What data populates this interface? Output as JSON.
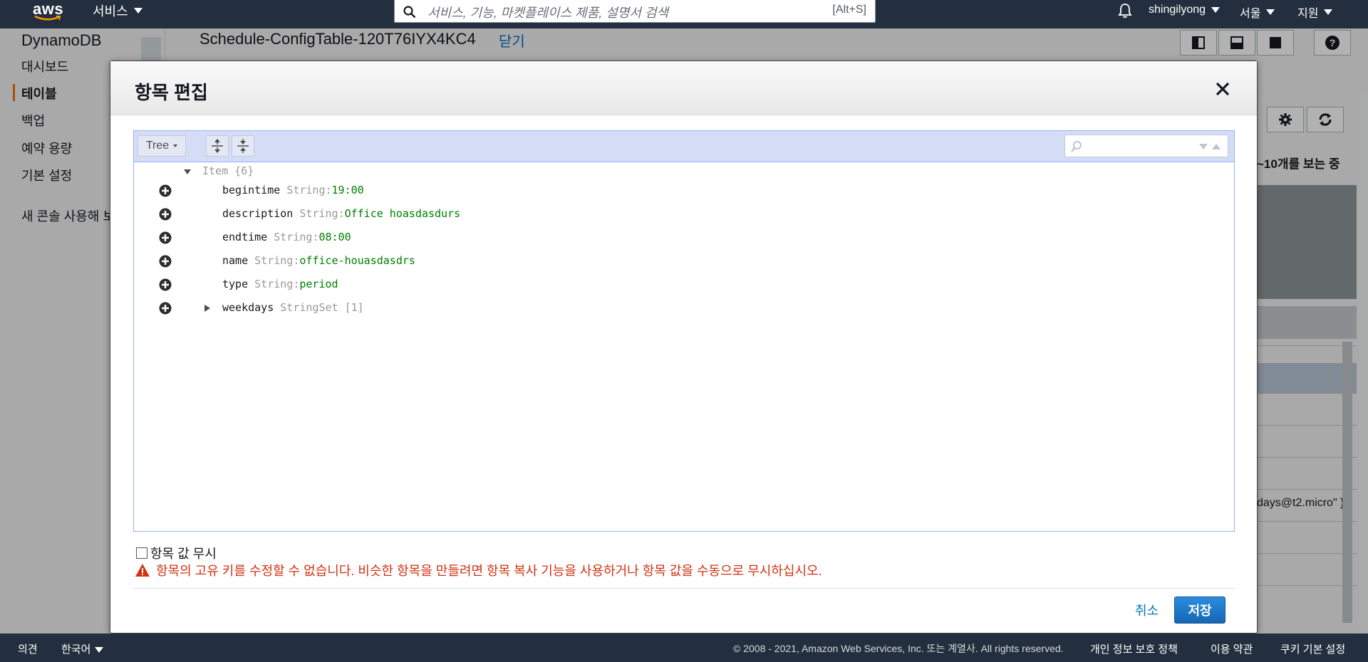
{
  "topnav": {
    "logo_text": "aws",
    "services_label": "서비스",
    "search_placeholder": "서비스, 기능, 마켓플레이스 제품, 설명서 검색",
    "search_shortcut": "[Alt+S]",
    "user": "shingilyong",
    "region": "서울",
    "support": "지원"
  },
  "sidebar": {
    "title": "DynamoDB",
    "items": [
      {
        "label": "대시보드"
      },
      {
        "label": "테이블",
        "active": true
      },
      {
        "label": "백업"
      },
      {
        "label": "예약 용량"
      },
      {
        "label": "기본 설정"
      }
    ],
    "new_console": "새 콘솔 사용해 보"
  },
  "background": {
    "table_title": "Schedule-ConfigTable-120T76IYX4KC4",
    "close_label": "닫기",
    "showing_text": "~10개를 보는 중",
    "cell_text": "days@t2.micro\" }"
  },
  "modal": {
    "title": "항목 편집",
    "editor": {
      "mode_label": "Tree",
      "root": {
        "label": "Item {6}"
      },
      "fields": [
        {
          "key": "begintime",
          "type": "String",
          "sep": ":",
          "value": "19:00"
        },
        {
          "key": "description",
          "type": "String",
          "sep": ":",
          "value": "Office hoasdasdurs"
        },
        {
          "key": "endtime",
          "type": "String",
          "sep": ":",
          "value": "08:00"
        },
        {
          "key": "name",
          "type": "String",
          "sep": ":",
          "value": "office-houasdasdrs"
        },
        {
          "key": "type",
          "type": "String",
          "sep": ":",
          "value": "period"
        },
        {
          "key": "weekdays",
          "type": "StringSet [1]",
          "sep": "",
          "value": ""
        }
      ]
    },
    "ignore_label": "항목 값 무시",
    "warning": "항목의 고유 키를 수정할 수 없습니다. 비슷한 항목을 만들려면 항목 복사 기능을 사용하거나 항목 값을 수동으로 무시하십시오.",
    "cancel_label": "취소",
    "save_label": "저장"
  },
  "footer": {
    "feedback": "의견",
    "language": "한국어",
    "copyright": "© 2008 - 2021, Amazon Web Services, Inc. 또는 계열사. All rights reserved.",
    "privacy": "개인 정보 보호 정책",
    "terms": "이용 약관",
    "cookies": "쿠키 기본 설정"
  },
  "colors": {
    "nav_bg": "#232f3e",
    "accent_orange": "#ec7211",
    "link_blue": "#0073bb",
    "error_red": "#d13212",
    "json_value_green": "#008000",
    "editor_menu": "#d5ddf6"
  }
}
